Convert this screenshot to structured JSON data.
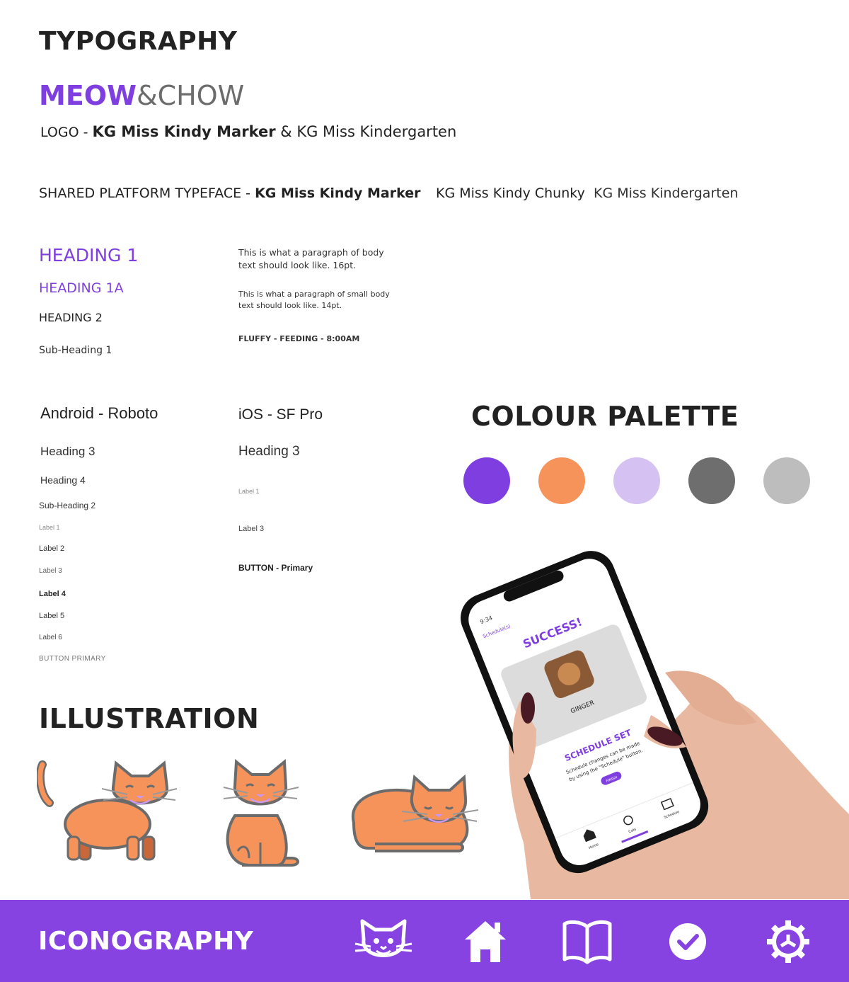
{
  "typography": {
    "title": "TYPOGRAPHY",
    "logo": {
      "part1": "MEOW",
      "amp": "&",
      "part2": "CHOW"
    },
    "logo_line": {
      "prefix": "LOGO - ",
      "font1": "KG Miss Kindy Marker",
      "amp": " & ",
      "font2": "KG Miss Kindergarten"
    },
    "shared": {
      "prefix": "SHARED PLATFORM TYPEFACE - ",
      "font1": "KG Miss Kindy Marker",
      "font2": "KG Miss Kindy Chunky",
      "font3": "KG Miss Kindergarten"
    },
    "headings": {
      "h1": "HEADING 1",
      "h1a": "HEADING 1A",
      "h2": "HEADING 2",
      "sub1": "Sub-Heading 1"
    },
    "body": {
      "p1": "This is what a paragraph of body text should look like. 16pt.",
      "p2": "This is what a paragraph of small body text should look like. 14pt.",
      "caps": "FLUFFY - FEEDING - 8:00AM"
    },
    "android": {
      "title": "Android - Roboto",
      "h3": "Heading 3",
      "h4": "Heading 4",
      "sub2": "Sub-Heading 2",
      "label1": "Label 1",
      "label2": "Label 2",
      "label3": "Label 3",
      "label4": "Label 4",
      "label5": "Label 5",
      "label6": "Label 6",
      "button": "BUTTON PRIMARY"
    },
    "ios": {
      "title": "iOS - SF Pro",
      "h3": "Heading 3",
      "label1": "Label 1",
      "label3": "Label 3",
      "button": "BUTTON - Primary"
    }
  },
  "palette": {
    "title": "COLOUR PALETTE",
    "colors": [
      "#7f3fe0",
      "#f5935a",
      "#d6c2f2",
      "#6e6e6e",
      "#bdbdbd"
    ]
  },
  "illustration": {
    "title": "ILLUSTRATION"
  },
  "phone": {
    "time": "9:34",
    "back": "Schedule(s)",
    "success": "SUCCESS!",
    "cat_name": "GINGER",
    "schedule_set": "SCHEDULE SET",
    "desc1": "Schedule changes can be made",
    "desc2": "by using the \"Schedule\" button.",
    "finish": "FINISH",
    "tab_home": "Home",
    "tab_cats": "Cats",
    "tab_schedule": "Schedule"
  },
  "iconography": {
    "title": "ICONOGRAPHY",
    "icons": [
      "cat-icon",
      "home-icon",
      "book-icon",
      "check-icon",
      "settings-icon"
    ]
  }
}
